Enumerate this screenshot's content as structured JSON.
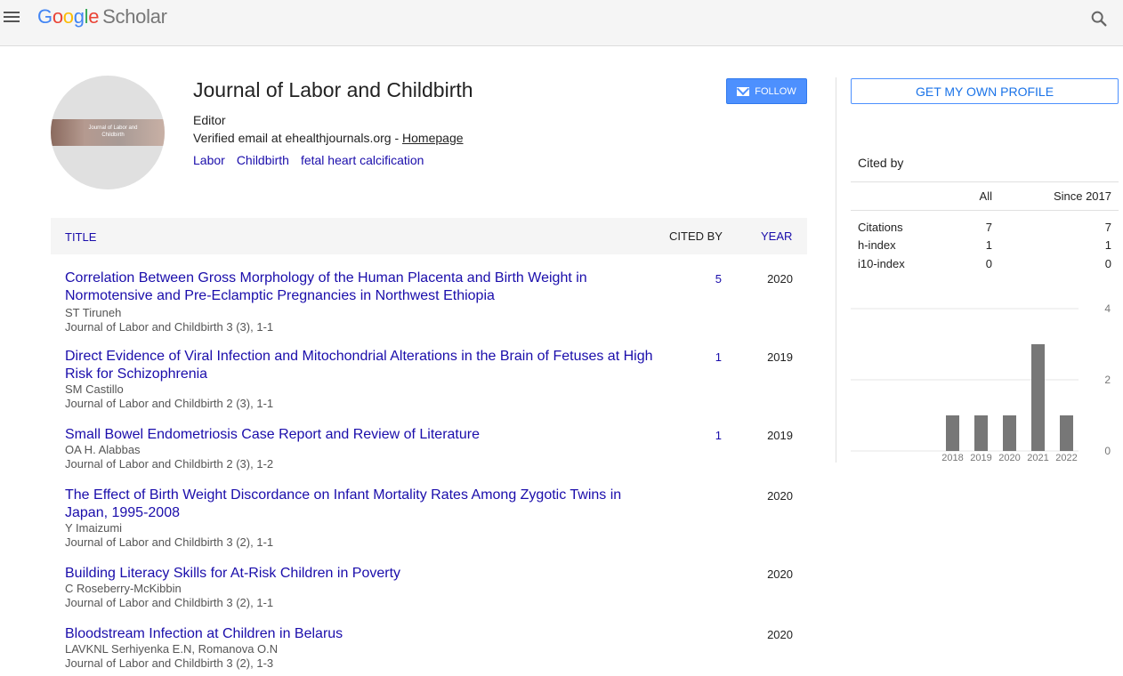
{
  "header": {
    "logo_letters": [
      "G",
      "o",
      "o",
      "g",
      "l",
      "e"
    ],
    "logo_suffix": "Scholar",
    "menu_icon": "hamburger-menu-icon",
    "search_icon": "search-icon"
  },
  "profile": {
    "avatar_text": "Journal of Labor and Childbirth",
    "name": "Journal of Labor and Childbirth",
    "role": "Editor",
    "email_text": "Verified email at ehealthjournals.org - ",
    "homepage_label": "Homepage",
    "interests": [
      "Labor",
      "Childbirth",
      "fetal heart calcification"
    ],
    "follow_label": "FOLLOW"
  },
  "table": {
    "col_title": "TITLE",
    "col_cited": "CITED BY",
    "col_year": "YEAR",
    "rows": [
      {
        "title": "Correlation Between Gross Morphology of the Human Placenta and Birth Weight in Normotensive and Pre-Eclamptic Pregnancies in Northwest Ethiopia",
        "authors": "ST Tiruneh",
        "venue": "Journal of Labor and Childbirth 3 (3), 1-1",
        "cites": "5",
        "year": "2020"
      },
      {
        "title": "Direct Evidence of Viral Infection and Mitochondrial Alterations in the Brain of Fetuses at High Risk for Schizophrenia",
        "authors": "SM Castillo",
        "venue": "Journal of Labor and Childbirth 2 (3), 1-1",
        "cites": "1",
        "year": "2019"
      },
      {
        "title": "Small Bowel Endometriosis Case Report and Review of Literature",
        "authors": "OA H. Alabbas",
        "venue": "Journal of Labor and Childbirth 2 (3), 1-2",
        "cites": "1",
        "year": "2019"
      },
      {
        "title": "The Effect of Birth Weight Discordance on Infant Mortality Rates Among Zygotic Twins in Japan, 1995-2008",
        "authors": "Y Imaizumi",
        "venue": "Journal of Labor and Childbirth 3 (2), 1-1",
        "cites": "",
        "year": "2020"
      },
      {
        "title": "Building Literacy Skills for At-Risk Children in Poverty",
        "authors": "C Roseberry-McKibbin",
        "venue": "Journal of Labor and Childbirth 3 (2), 1-1",
        "cites": "",
        "year": "2020"
      },
      {
        "title": "Bloodstream Infection at Children in Belarus",
        "authors": "LAVKNL Serhiyenka E.N, Romanova O.N",
        "venue": "Journal of Labor and Childbirth 3 (2), 1-3",
        "cites": "",
        "year": "2020"
      }
    ]
  },
  "sidebar": {
    "own_profile_label": "GET MY OWN PROFILE",
    "cited_by_title": "Cited by",
    "head_all": "All",
    "head_since": "Since 2017",
    "stats": [
      {
        "label": "Citations",
        "all": "7",
        "since": "7"
      },
      {
        "label": "h-index",
        "all": "1",
        "since": "1"
      },
      {
        "label": "i10-index",
        "all": "0",
        "since": "0"
      }
    ]
  },
  "chart_data": {
    "type": "bar",
    "categories": [
      "2018",
      "2019",
      "2020",
      "2021",
      "2022"
    ],
    "values": [
      1,
      1,
      1,
      3,
      1
    ],
    "ylim": [
      0,
      4
    ],
    "yticks": [
      0,
      2,
      4
    ],
    "grid": true,
    "bar_color": "#777777"
  },
  "colors": {
    "link": "#1a0dab",
    "follow_button": "#4d90fe",
    "header_bg": "#f5f5f5"
  }
}
